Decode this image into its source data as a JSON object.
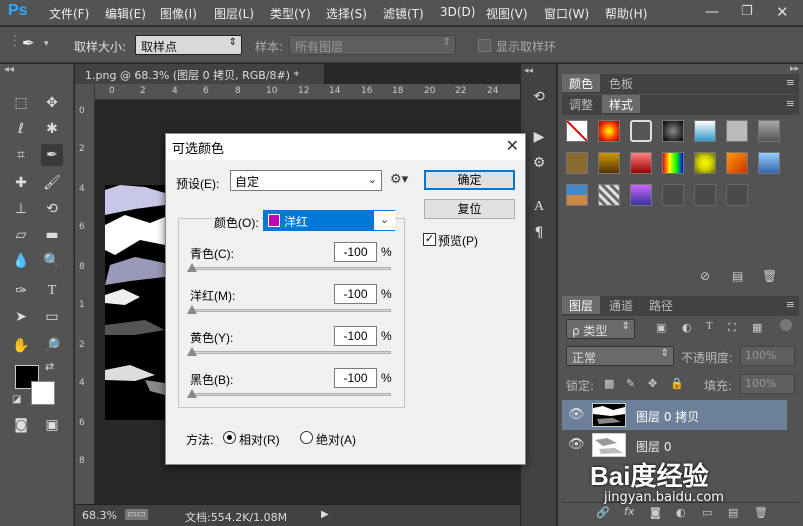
{
  "app": {
    "logo": "Ps"
  },
  "menu": [
    "文件(F)",
    "编辑(E)",
    "图像(I)",
    "图层(L)",
    "类型(Y)",
    "选择(S)",
    "滤镜(T)",
    "3D(D)",
    "视图(V)",
    "窗口(W)",
    "帮助(H)"
  ],
  "options": {
    "sample_size_label": "取样大小:",
    "sample_size_value": "取样点",
    "sample_label": "样本:",
    "sample_value": "所有图层",
    "show_ring_label": "显示取样环"
  },
  "document": {
    "tab_title": "1.png @ 68.3% (图层 0 拷贝, RGB/8#) *",
    "tab_close": "×",
    "ruler_h": [
      "0",
      "2",
      "4",
      "6",
      "8",
      "10",
      "12",
      "14",
      "16",
      "18",
      "20",
      "22",
      "24"
    ],
    "ruler_v": [
      "0",
      "2",
      "4",
      "6",
      "8",
      "1",
      "2",
      "4",
      "6",
      "8"
    ],
    "zoom": "68.3%",
    "doc_info": "文档:554.2K/1.08M"
  },
  "dialog": {
    "title": "可选颜色",
    "close": "✕",
    "preset_label": "预设(E):",
    "preset_value": "自定",
    "color_label": "颜色(O):",
    "color_value": "洋红",
    "color_swatch": "#c000c0",
    "ok": "确定",
    "reset": "复位",
    "preview_label": "预览(P)",
    "preview_checked": "✓",
    "sliders": [
      {
        "label": "青色(C):",
        "value": "-100",
        "unit": "%"
      },
      {
        "label": "洋红(M):",
        "value": "-100",
        "unit": "%"
      },
      {
        "label": "黄色(Y):",
        "value": "-100",
        "unit": "%"
      },
      {
        "label": "黑色(B):",
        "value": "-100",
        "unit": "%"
      }
    ],
    "method_label": "方法:",
    "relative_label": "相对(R)",
    "absolute_label": "绝对(A)"
  },
  "panels": {
    "top_tabs": [
      "颜色",
      "色板"
    ],
    "style_tabs": [
      "调整",
      "样式"
    ],
    "layer_tabs": [
      "图层",
      "通道",
      "路径"
    ],
    "kind_filter": "ρ 类型",
    "blend_mode": "正常",
    "opacity_label": "不透明度:",
    "opacity_value": "100%",
    "lock_label": "锁定:",
    "fill_label": "填充:",
    "fill_value": "100%",
    "layers": [
      {
        "name": "图层 0 拷贝",
        "selected": true
      },
      {
        "name": "图层 0",
        "selected": false
      }
    ]
  },
  "watermark": {
    "brand": "Bai度经验",
    "url": "jingyan.baidu.com"
  },
  "colors": {
    "accent": "#0078d7",
    "ps_blue": "#30a8ff",
    "magenta": "#c000c0",
    "layer_selected": "#6d8099"
  }
}
